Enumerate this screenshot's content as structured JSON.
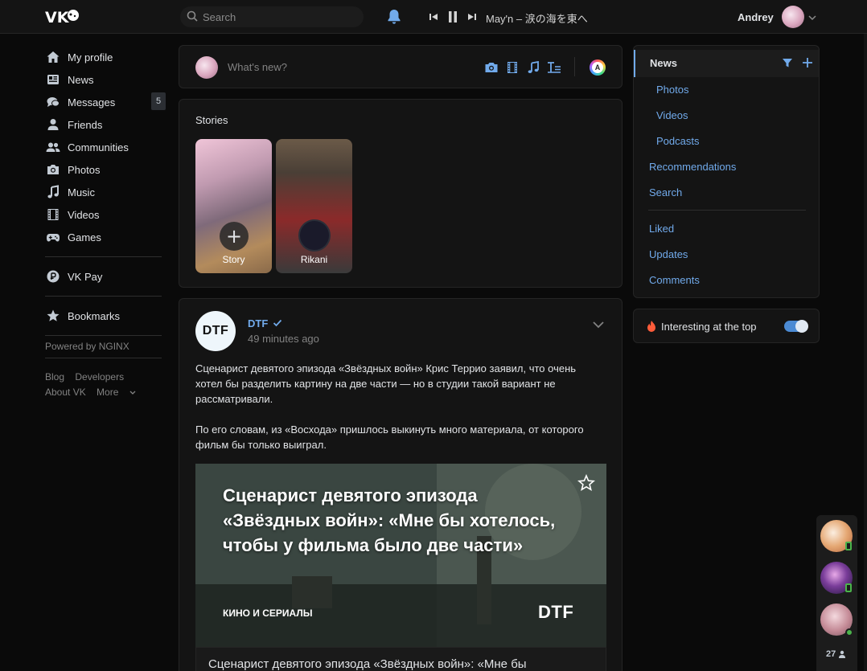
{
  "header": {
    "logo": "vk-logo",
    "search_placeholder": "Search",
    "player": {
      "track": "May'n – 涙の海を東へ"
    },
    "user_name": "Andrey"
  },
  "leftnav": {
    "items": [
      {
        "label": "My profile",
        "icon": "home-icon"
      },
      {
        "label": "News",
        "icon": "newspaper-icon"
      },
      {
        "label": "Messages",
        "icon": "chat-icon",
        "badge": "5"
      },
      {
        "label": "Friends",
        "icon": "user-icon"
      },
      {
        "label": "Communities",
        "icon": "users-icon"
      },
      {
        "label": "Photos",
        "icon": "camera-icon"
      },
      {
        "label": "Music",
        "icon": "music-icon"
      },
      {
        "label": "Videos",
        "icon": "film-icon"
      },
      {
        "label": "Games",
        "icon": "gamepad-icon"
      }
    ],
    "vkpay": "VK Pay",
    "bookmarks": "Bookmarks",
    "powered": "Powered by NGINX",
    "footer": {
      "blog": "Blog",
      "developers": "Developers",
      "about": "About VK",
      "more": "More"
    }
  },
  "composer": {
    "placeholder": "What's new?"
  },
  "stories": {
    "title": "Stories",
    "items": [
      {
        "label": "Story"
      },
      {
        "label": "Rikani"
      }
    ]
  },
  "post": {
    "author": "DTF",
    "avatar_text": "DTF",
    "time": "49 minutes ago",
    "paragraphs": [
      "Сценарист девятого эпизода «Звёздных войн» Крис Террио заявил, что очень хотел бы разделить картину на две части — но в студии такой вариант не рассматривали.",
      "По его словам, из «Восхода» пришлось выкинуть много материала, от которого фильм бы только выиграл."
    ],
    "media": {
      "headline": "Сценарист девятого эпизода «Звёздных войн»: «Мне бы хотелось, чтобы у фильма было две части»",
      "category": "КИНО И СЕРИАЛЫ",
      "brand": "DTF"
    },
    "link_caption": "Сценарист девятого эпизода «Звёздных войн»: «Мне бы"
  },
  "rightnav": {
    "active": "News",
    "sub": [
      "Photos",
      "Videos",
      "Podcasts"
    ],
    "main": [
      "Recommendations",
      "Search"
    ],
    "extra": [
      "Liked",
      "Updates",
      "Comments"
    ]
  },
  "interesting": {
    "label": "Interesting at the top",
    "enabled": true
  },
  "dock": {
    "count": "27"
  },
  "colors": {
    "accent": "#71aaeb",
    "background": "#0a0a0a",
    "card": "#141414",
    "online": "#4bb34b"
  }
}
